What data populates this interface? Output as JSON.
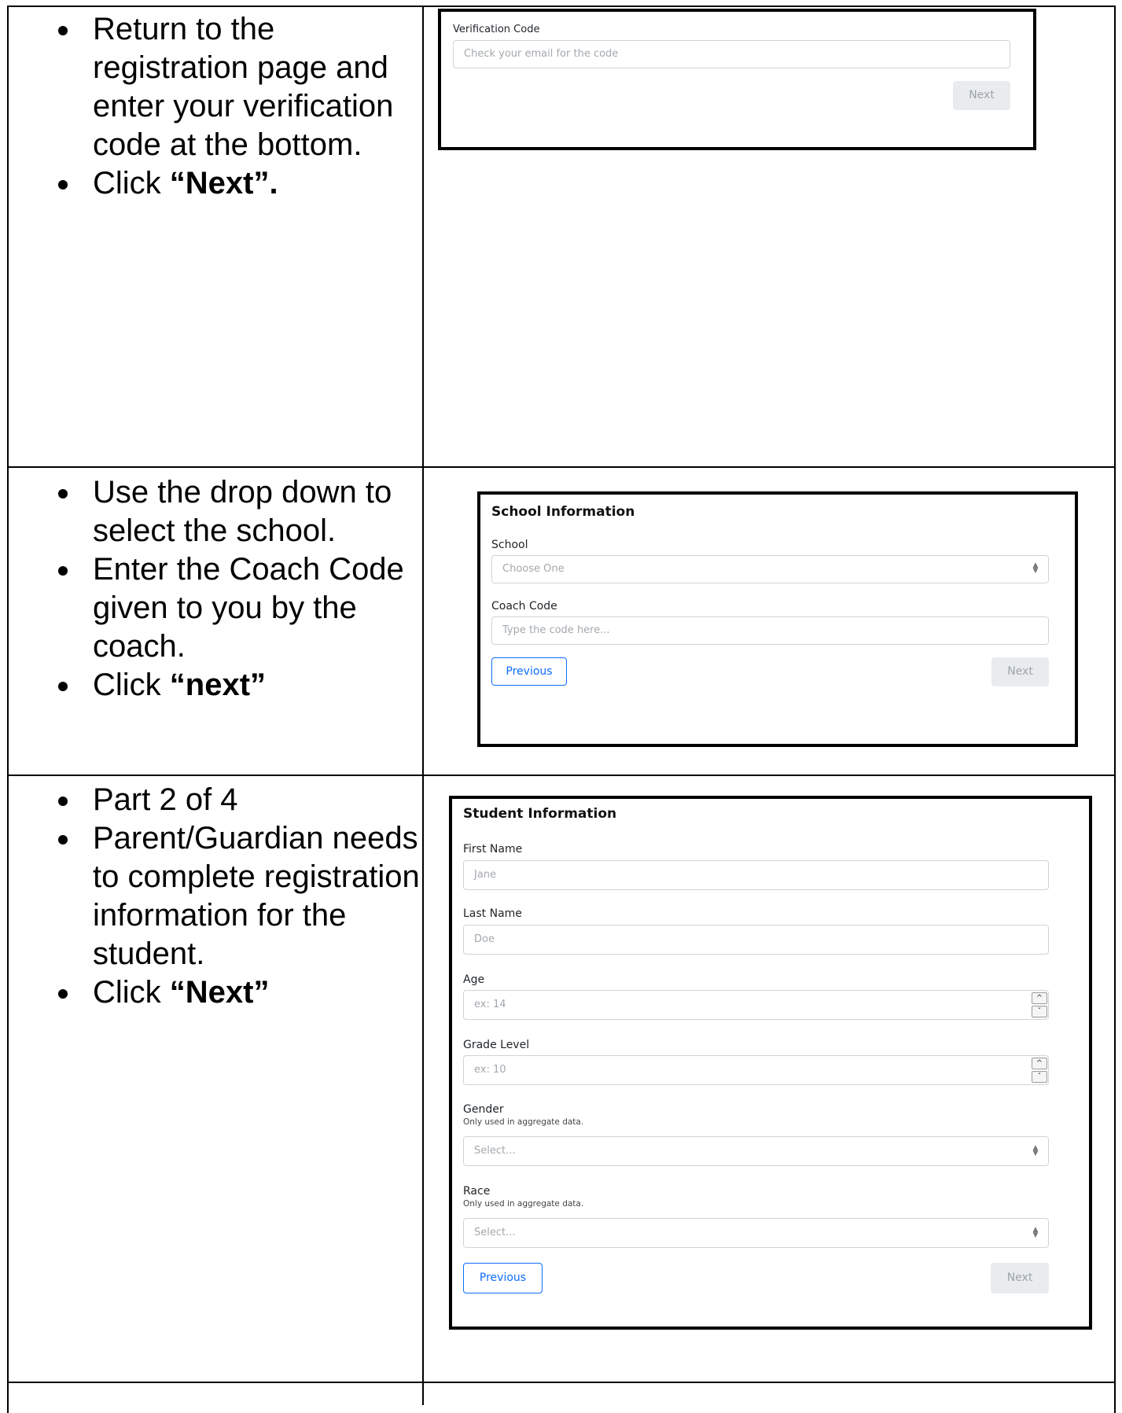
{
  "sections": [
    {
      "steps": [
        {
          "text": "Return to the registration page and enter your verification code at the bottom.",
          "bold": ""
        },
        {
          "text": "Click ",
          "bold": "“Next”."
        }
      ],
      "panel": {
        "title": "",
        "verification_label": "Verification Code",
        "verification_placeholder": "Check your email for the code",
        "next_label": "Next"
      }
    },
    {
      "steps": [
        {
          "text": "Use the drop down to select the school.",
          "bold": ""
        },
        {
          "text": "Enter the Coach Code given to you by the coach.",
          "bold": ""
        },
        {
          "text": "Click ",
          "bold": "“next”"
        }
      ],
      "panel": {
        "title": "School Information",
        "school_label": "School",
        "school_placeholder": "Choose One",
        "coach_code_label": "Coach Code",
        "coach_code_placeholder": "Type the code here...",
        "previous_label": "Previous",
        "next_label": "Next"
      }
    },
    {
      "steps": [
        {
          "text": "Part 2 of 4",
          "bold": ""
        },
        {
          "text": "Parent/Guardian needs to complete registration information for the student.",
          "bold": ""
        },
        {
          "text": "Click ",
          "bold": "“Next”"
        }
      ],
      "panel": {
        "title": "Student Information",
        "first_name_label": "First Name",
        "first_name_placeholder": "Jane",
        "last_name_label": "Last Name",
        "last_name_placeholder": "Doe",
        "age_label": "Age",
        "age_placeholder": "ex: 14",
        "grade_label": "Grade Level",
        "grade_placeholder": "ex: 10",
        "gender_label": "Gender",
        "gender_help": "Only used in aggregate data.",
        "gender_placeholder": "Select...",
        "race_label": "Race",
        "race_help": "Only used in aggregate data.",
        "race_placeholder": "Select...",
        "previous_label": "Previous",
        "next_label": "Next"
      }
    }
  ],
  "icons": {
    "select_arrow": "up-down-chevron-icon",
    "spin_up": "chevron-up-icon",
    "spin_down": "chevron-down-icon"
  }
}
